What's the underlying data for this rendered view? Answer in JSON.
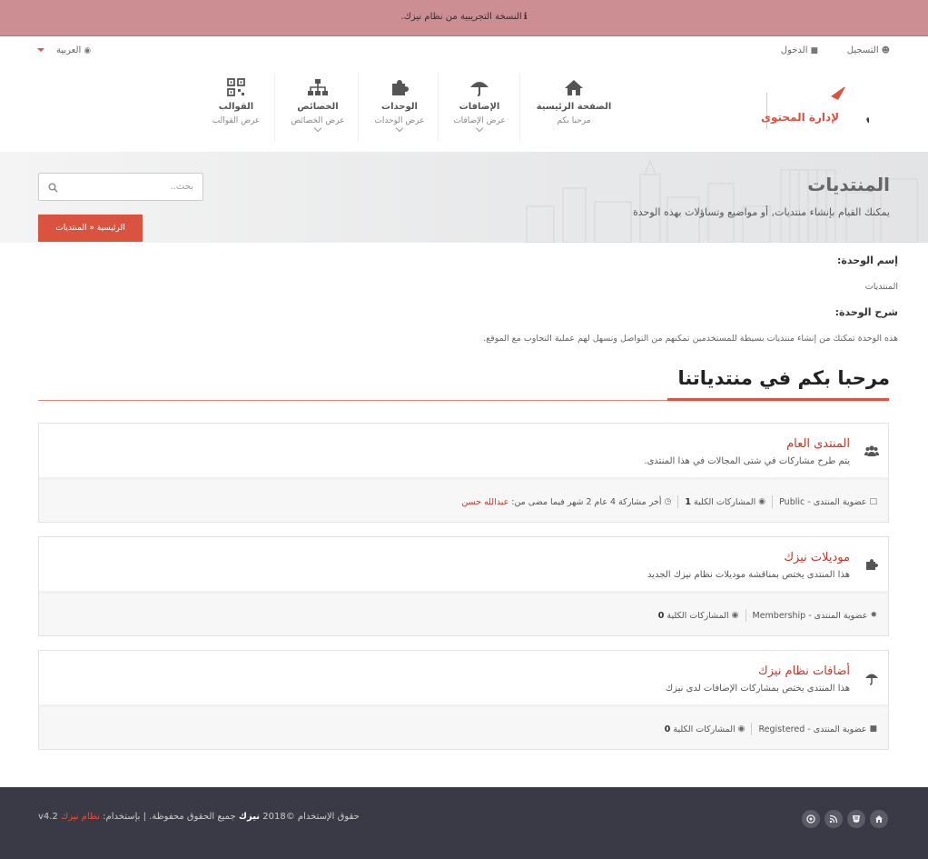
{
  "banner": {
    "prefix": "ℹ",
    "text": "النسخة التجريبية من نظام نيزك."
  },
  "utility": {
    "register": "التسجيل",
    "login": "الدخول",
    "language": "العربية"
  },
  "nav": [
    {
      "title": "الصفحة الرئيسية",
      "sub": "مرحبا بكم",
      "icon": "home-icon"
    },
    {
      "title": "الإضافات",
      "sub": "عرض الإضافات",
      "icon": "umbrella-icon"
    },
    {
      "title": "الوحدات",
      "sub": "عرض الوحدات",
      "icon": "puzzle-icon"
    },
    {
      "title": "الخصائص",
      "sub": "عرض الخصائص",
      "icon": "sitemap-icon"
    },
    {
      "title": "القوالب",
      "sub": "عرض القوالب",
      "icon": "qrcode-icon"
    }
  ],
  "logo": {
    "name": "نيزك",
    "tagline": "لإدارة المحتوى"
  },
  "hero": {
    "title": "المنتديات",
    "subtitle": "يمكنك القيام بإنشاء منتديات, أو مواضيع وتساؤلات بهذه الوحدة",
    "search_placeholder": "بحث..",
    "breadcrumb": "الرئيسية « المنتديات"
  },
  "module": {
    "name_label": "إسم الوحدة:",
    "name_value": "المنتديات",
    "desc_label": "شرح الوحدة:",
    "desc_value": "هذه الوحدة تمكنك من إنشاء منتديات بسيطة للمستخدمين تمكنهم من التواصل وتسهل لهم عملية التجاوب مع الموقع."
  },
  "welcome": "مرحبا بكم في منتدياتنا",
  "forums": [
    {
      "name": "المنتدى العام",
      "desc": "يتم طرح مشاركات في شتى المجالات في هذا المنتدى.",
      "icon": "users-icon",
      "membership": "عضوية المنتدى - Public",
      "posts_label": "المشاركات الكلية",
      "posts": "1",
      "last_post": "أخر مشاركة 4 عام 2 شهر فيما مضى من:",
      "last_user": "عبدالله حسن"
    },
    {
      "name": "موديلات نيزك",
      "desc": "هذا المنتدى يختص بمناقشة موديلات نظام نيزك الجديد",
      "icon": "puzzle-icon",
      "membership": "عضوية المنتدى - Membership",
      "posts_label": "المشاركات الكلية",
      "posts": "0"
    },
    {
      "name": "أضافات نظام نيزك",
      "desc": "هذا المنتدى يختص بمشاركات الإضافات لدى نيزك",
      "icon": "umbrella-icon",
      "membership": "عضوية المنتدى - Registered",
      "posts_label": "المشاركات الكلية",
      "posts": "0"
    }
  ],
  "footer": {
    "copy": "حقوق الإستخدام ©2018",
    "brand": "نيزك",
    "rights": "جميع الحقوق محفوظة. | بإستخدام:",
    "system": "نظام نيزك",
    "version": "v4.2",
    "social": [
      "home-icon",
      "html5-icon",
      "rss-icon",
      "dribbble-icon"
    ]
  },
  "colors": {
    "accent": "#d9533f",
    "banner": "#cc8d93",
    "footer": "#393a45"
  }
}
